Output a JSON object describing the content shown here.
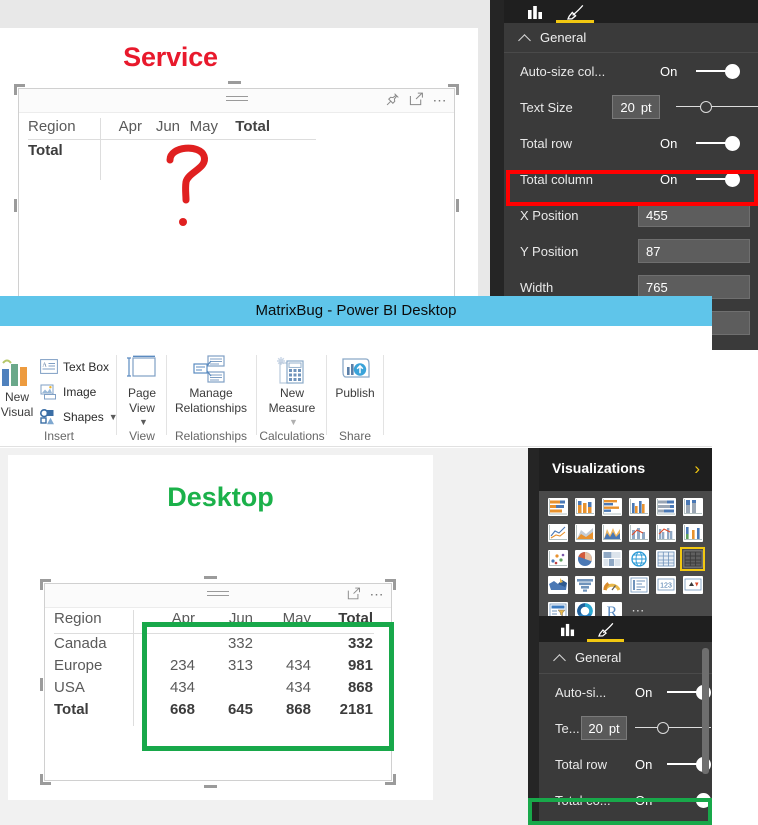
{
  "window": {
    "title": "MatrixBug - Power BI Desktop"
  },
  "service": {
    "label": "Service",
    "label_color": "#e8192c",
    "annotation": "question-mark",
    "header_icons": [
      "pin-icon",
      "focus-mode-icon",
      "more-options-icon"
    ],
    "matrix": {
      "columns": [
        "Region",
        "Apr",
        "Jun",
        "May",
        "Total"
      ],
      "rows": [
        {
          "region": "Total",
          "Apr": "",
          "Jun": "",
          "May": "",
          "Total": ""
        }
      ]
    }
  },
  "desktop": {
    "label": "Desktop",
    "label_color": "#1bb14a",
    "header_icons": [
      "focus-mode-icon",
      "more-options-icon"
    ],
    "matrix": {
      "columns": [
        "Region",
        "Apr",
        "Jun",
        "May",
        "Total"
      ],
      "rows": [
        {
          "region": "Canada",
          "Apr": "",
          "Jun": "332",
          "May": "",
          "Total": "332"
        },
        {
          "region": "Europe",
          "Apr": "234",
          "Jun": "313",
          "May": "434",
          "Total": "981"
        },
        {
          "region": "USA",
          "Apr": "434",
          "Jun": "",
          "May": "434",
          "Total": "868"
        },
        {
          "region": "Total",
          "Apr": "668",
          "Jun": "645",
          "May": "868",
          "Total": "2181"
        }
      ]
    }
  },
  "ribbon": {
    "groups": [
      {
        "label": "Insert",
        "big": {
          "line1": "New",
          "line2": "Visual",
          "icon": "new-visual-icon"
        },
        "small": [
          {
            "label": "Text Box",
            "icon": "text-box-icon",
            "caret": false
          },
          {
            "label": "Image",
            "icon": "image-icon",
            "caret": false
          },
          {
            "label": "Shapes",
            "icon": "shapes-icon",
            "caret": true
          }
        ]
      },
      {
        "label": "View",
        "big": {
          "line1": "Page",
          "line2": "View",
          "caret": true,
          "icon": "page-view-icon"
        }
      },
      {
        "label": "Relationships",
        "big": {
          "line1": "Manage",
          "line2": "Relationships",
          "caret": false,
          "icon": "manage-relationships-icon"
        }
      },
      {
        "label": "Calculations",
        "big": {
          "line1": "New",
          "line2": "Measure",
          "caret": true,
          "icon": "new-measure-icon"
        }
      },
      {
        "label": "Share",
        "big": {
          "line1": "Publish",
          "line2": "",
          "caret": false,
          "icon": "publish-icon"
        }
      }
    ]
  },
  "format_panel_top": {
    "tabs": [
      {
        "name": "fields-tab",
        "icon": "bar-chart-icon",
        "selected": false
      },
      {
        "name": "format-tab",
        "icon": "paintbrush-icon",
        "selected": true
      }
    ],
    "section": "General",
    "rows": [
      {
        "name": "Auto-size col...",
        "type": "toggle",
        "value": "On"
      },
      {
        "name": "Text Size",
        "type": "stepper-slider",
        "value": "20",
        "unit": "pt"
      },
      {
        "name": "Total row",
        "type": "toggle",
        "value": "On"
      },
      {
        "name": "Total column",
        "type": "toggle",
        "value": "On",
        "highlight": "#ff0000"
      },
      {
        "name": "X Position",
        "type": "text",
        "value": "455"
      },
      {
        "name": "Y Position",
        "type": "text",
        "value": "87"
      },
      {
        "name": "Width",
        "type": "text",
        "value": "765"
      }
    ]
  },
  "visualizations_panel": {
    "title": "Visualizations",
    "expand_icon": "chevron-right-icon",
    "icons": [
      "stacked-bar-chart",
      "stacked-column-chart",
      "clustered-bar-chart",
      "clustered-column-chart",
      "100-stacked-bar-chart",
      "100-stacked-column-chart",
      "line-chart",
      "area-chart",
      "stacked-area-chart",
      "line-and-stacked-column-chart",
      "line-and-clustered-column-chart",
      "ribbon-chart",
      "scatter-chart",
      "pie-chart",
      "treemap",
      "map",
      "table",
      "matrix",
      "filled-map",
      "funnel",
      "gauge",
      "multi-row-card",
      "card",
      "kpi",
      "slicer",
      "donut-chart",
      "r-script-visual",
      "more-visuals"
    ],
    "selected_icon": "matrix",
    "tabs": [
      {
        "name": "fields-tab",
        "icon": "bar-chart-icon",
        "selected": false
      },
      {
        "name": "format-tab",
        "icon": "paintbrush-icon",
        "selected": true
      }
    ]
  },
  "format_panel_bottom": {
    "section": "General",
    "rows": [
      {
        "name": "Auto-si...",
        "type": "toggle",
        "value": "On"
      },
      {
        "name": "Te...",
        "type": "stepper-slider",
        "value": "20",
        "unit": "pt"
      },
      {
        "name": "Total row",
        "type": "toggle",
        "value": "On"
      },
      {
        "name": "Total co...",
        "type": "toggle",
        "value": "On",
        "highlight": "#18a84a"
      }
    ]
  }
}
